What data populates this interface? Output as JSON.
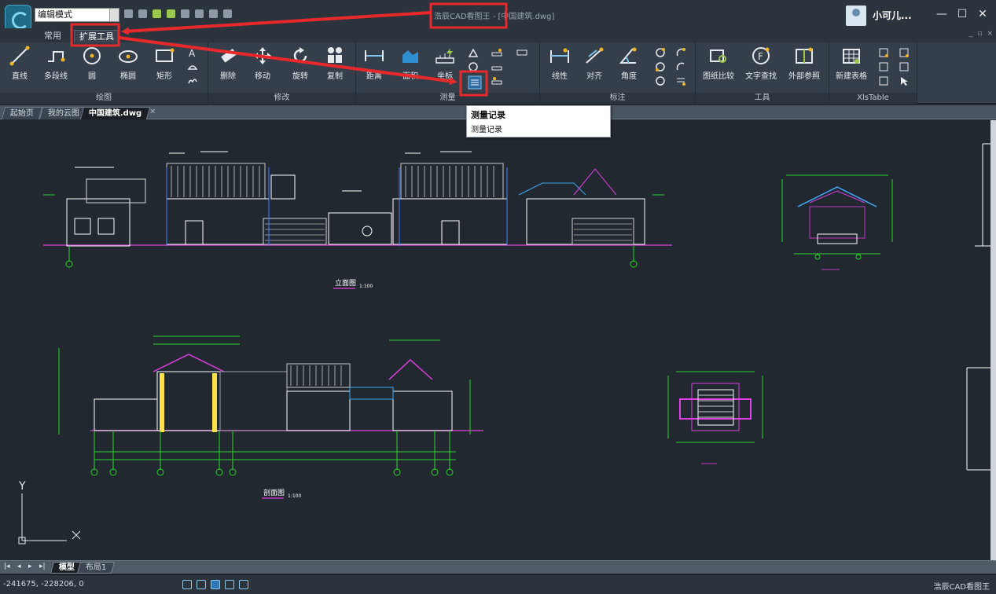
{
  "window": {
    "mode_select": "编辑模式",
    "title": "浩辰CAD看图王 - [中国建筑.dwg]",
    "user_name": "小可儿...",
    "buttons": {
      "minimize": "—",
      "maximize": "☐",
      "close": "✕"
    },
    "mdi": [
      "_",
      "▫",
      "×"
    ]
  },
  "ribbon_tabs": [
    "常用",
    "扩展工具"
  ],
  "ribbon": {
    "panels": {
      "draw": "绘图",
      "modify": "修改",
      "measure": "测量",
      "annotate": "标注",
      "tools": "工具",
      "xls": "XlsTable"
    },
    "draw_tools": [
      "直线",
      "多段线",
      "圆",
      "椭圆",
      "矩形"
    ],
    "modify_tools": [
      "删除",
      "移动",
      "旋转",
      "复制"
    ],
    "measure_tools": [
      "距离",
      "面积",
      "坐标"
    ],
    "annotate_tools": [
      "线性",
      "对齐",
      "角度"
    ],
    "tools_tools": [
      "图纸比较",
      "文字查找",
      "外部参照"
    ],
    "xls_tools": [
      "新建表格"
    ]
  },
  "doc_tabs": [
    "起始页",
    "我的云图",
    "中国建筑.dwg"
  ],
  "tooltip": {
    "title": "测量记录",
    "desc": "测量记录"
  },
  "drawing": {
    "elevation_label": "立面图",
    "elevation_scale": "1:100",
    "section_label": "剖面图",
    "section_scale": "1:100",
    "ucs_y": "Y"
  },
  "layout_tabs": [
    "模型",
    "布局1"
  ],
  "nav_buttons": [
    "|◂",
    "◂",
    "▸",
    "▸|"
  ],
  "status": {
    "coords": "-241675, -228206, 0",
    "app_name": "浩辰CAD看图王"
  },
  "colors": {
    "highlight_red": "#e8292b",
    "canvas_bg": "#212830",
    "ribbon_bg": "#353f4b"
  }
}
